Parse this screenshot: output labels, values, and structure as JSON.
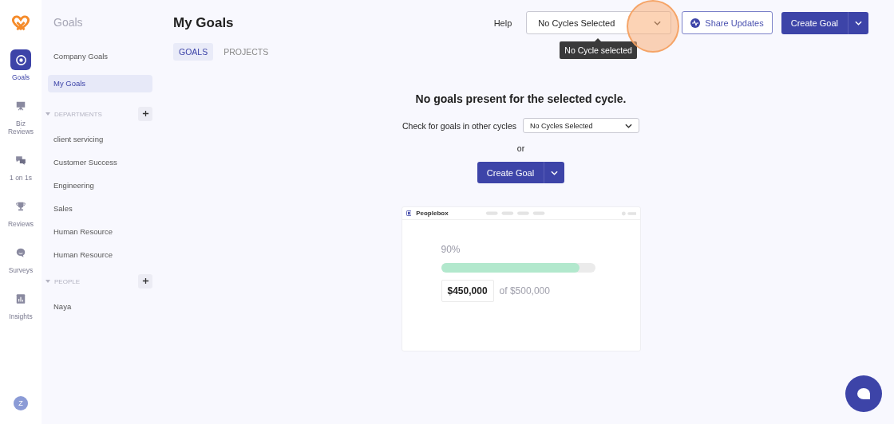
{
  "rail": {
    "items": [
      {
        "label": "Goals",
        "selected": true
      },
      {
        "label": "Biz Reviews",
        "selected": false
      },
      {
        "label": "1 on 1s",
        "selected": false
      },
      {
        "label": "Reviews",
        "selected": false
      },
      {
        "label": "Surveys",
        "selected": false
      },
      {
        "label": "Insights",
        "selected": false
      }
    ],
    "avatar": "Z"
  },
  "sidebar": {
    "title": "Goals",
    "items": [
      {
        "label": "Company Goals",
        "selected": false
      },
      {
        "label": "My Goals",
        "selected": true
      }
    ],
    "sections": [
      {
        "title": "DEPARTMENTS",
        "expanded": true,
        "items": [
          "client servicing",
          "Customer Success",
          "Engineering",
          "Sales",
          "Human Resource",
          "Human Resource"
        ]
      },
      {
        "title": "PEOPLE",
        "expanded": true,
        "items": [
          "Naya"
        ]
      }
    ]
  },
  "header": {
    "title": "My Goals",
    "help": "Help",
    "cycle_select": {
      "value": "No Cycles Selected"
    },
    "tooltip": "No Cycle selected",
    "share_button": "Share Updates",
    "create_button": "Create Goal"
  },
  "tabs": [
    {
      "label": "GOALS",
      "selected": true
    },
    {
      "label": "PROJECTS",
      "selected": false
    }
  ],
  "empty_state": {
    "heading": "No goals present for the selected cycle.",
    "prompt": "Check for goals in other cycles",
    "cycle_select": {
      "value": "No Cycles Selected"
    },
    "or": "or",
    "create_button": "Create Goal",
    "illustration": {
      "brand": "Peoplebox",
      "percent": "90%",
      "level": 0.9,
      "amount": "$450,000",
      "target": "of $500,000"
    }
  }
}
